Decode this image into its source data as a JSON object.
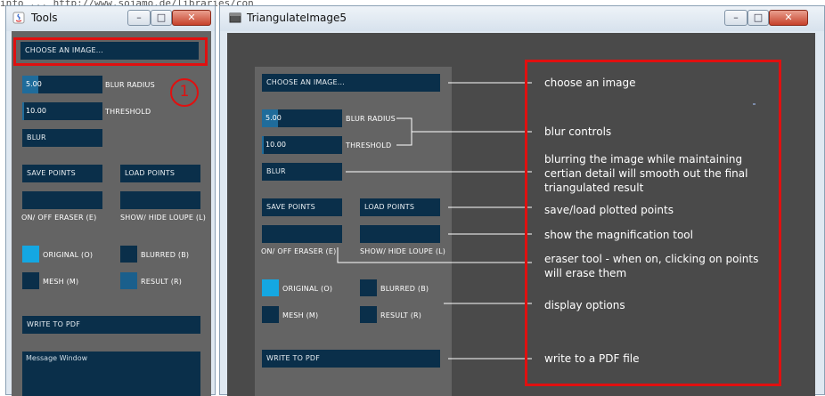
{
  "background": {
    "url_fragment": "info ... http://www.sojamo.de/libraries/con"
  },
  "tools_window": {
    "title": "Tools",
    "choose_image": "CHOOSE AN IMAGE...",
    "blur_radius": {
      "value": "5.00",
      "label": "BLUR RADIUS",
      "fill": 0.2
    },
    "threshold": {
      "value": "10.00",
      "label": "THRESHOLD",
      "fill": 0.02
    },
    "blur": "BLUR",
    "save_points": "SAVE POINTS",
    "load_points": "LOAD POINTS",
    "eraser_label": "ON/ OFF ERASER (E)",
    "loupe_label": "SHOW/ HIDE LOUPE (L)",
    "toggles": {
      "original": "ORIGINAL (O)",
      "blurred": "BLURRED (B)",
      "mesh": "MESH (M)",
      "result": "RESULT (R)"
    },
    "write_pdf": "WRITE TO PDF",
    "message_window": "Message Window",
    "marker": "1"
  },
  "main_window": {
    "title": "TriangulateImage5",
    "choose_image": "CHOOSE AN IMAGE...",
    "blur_radius": {
      "value": "5.00",
      "label": "BLUR RADIUS",
      "fill": 0.2
    },
    "threshold": {
      "value": "10.00",
      "label": "THRESHOLD",
      "fill": 0.02
    },
    "blur": "BLUR",
    "save_points": "SAVE POINTS",
    "load_points": "LOAD POINTS",
    "eraser_label": "ON/ OFF ERASER (E)",
    "loupe_label": "SHOW/ HIDE LOUPE (L)",
    "toggles": {
      "original": "ORIGINAL (O)",
      "blurred": "BLURRED (B)",
      "mesh": "MESH (M)",
      "result": "RESULT (R)"
    },
    "write_pdf": "WRITE TO PDF"
  },
  "annotations": {
    "choose": "choose an image",
    "blur_controls": "blur controls",
    "blurring": "blurring the image while maintaining certian detail will smooth out the final triangulated result",
    "save_load": "save/load plotted points",
    "magnification": "show the magnification tool",
    "eraser": "eraser tool - when on, clicking on points will erase them",
    "display": "display options",
    "pdf": "write to a PDF file"
  },
  "colors": {
    "panel_bg": "#646464",
    "control": "#0a2f4a",
    "control_active": "#14a7e2",
    "slider_fill": "#1f6c9b",
    "highlight": "#e01010"
  },
  "icons": {
    "tools_app": "java-icon",
    "main_app": "window-icon"
  }
}
